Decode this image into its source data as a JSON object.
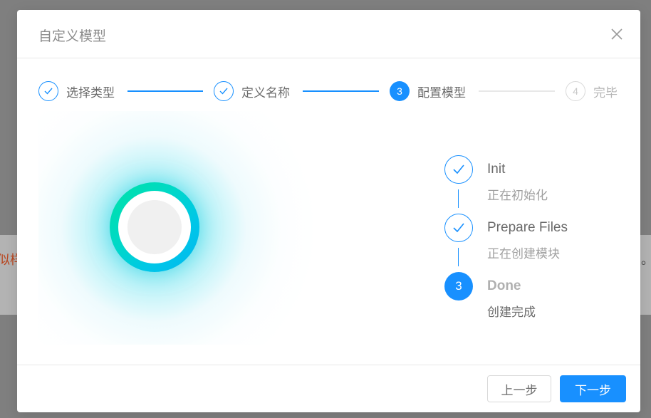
{
  "background": {
    "left_fragment": "似样",
    "right_fragment": "性。"
  },
  "dialog": {
    "title": "自定义模型",
    "close_icon": "close-icon"
  },
  "steps": [
    {
      "number": "1",
      "label": "选择类型",
      "status": "finish"
    },
    {
      "number": "2",
      "label": "定义名称",
      "status": "finish"
    },
    {
      "number": "3",
      "label": "配置模型",
      "status": "process"
    },
    {
      "number": "4",
      "label": "完毕",
      "status": "wait"
    }
  ],
  "progress": [
    {
      "number": "1",
      "title": "Init",
      "description": "正在初始化",
      "status": "finish"
    },
    {
      "number": "2",
      "title": "Prepare Files",
      "description": "正在创建模块",
      "status": "finish"
    },
    {
      "number": "3",
      "title": "Done",
      "description": "创建完成",
      "status": "process"
    }
  ],
  "footer": {
    "prev_label": "上一步",
    "next_label": "下一步"
  },
  "colors": {
    "primary": "#1890ff",
    "glow_start": "#00e2a5",
    "glow_end": "#00b8ef"
  }
}
